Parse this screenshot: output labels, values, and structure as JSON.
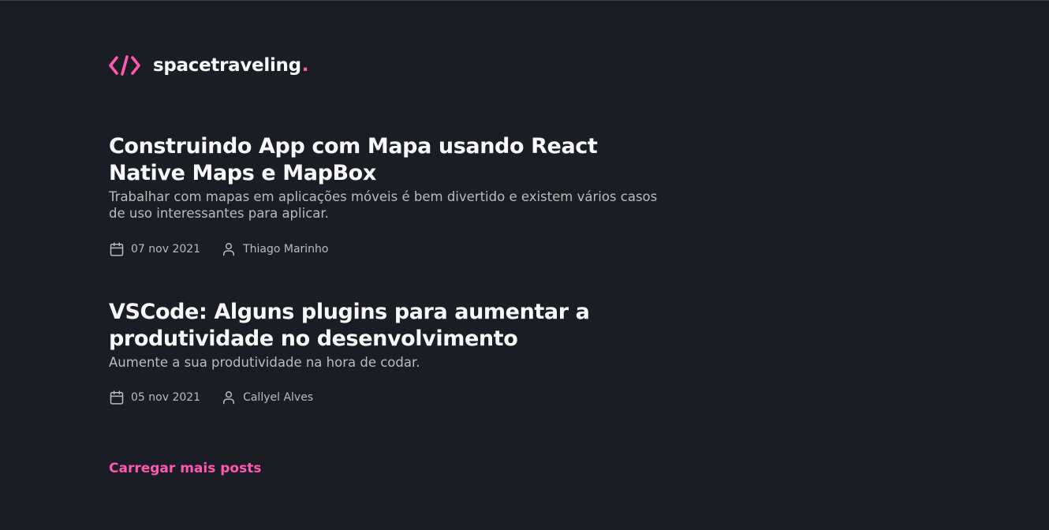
{
  "header": {
    "logo_text": "spacetraveling",
    "logo_dot": ".",
    "accent_color": "#ff57b2",
    "logo_icon": "code-brackets-icon"
  },
  "posts": [
    {
      "title": "Construindo App com Mapa usando React Native Maps e MapBox",
      "subtitle": "Trabalhar com mapas em aplicações móveis é bem divertido e existem vários casos de uso interessantes para aplicar.",
      "date": "07 nov 2021",
      "author": "Thiago Marinho"
    },
    {
      "title": "VSCode: Alguns plugins para aumentar a produtividade no desenvolvimento",
      "subtitle": "Aumente a sua produtividade na hora de codar.",
      "date": "05 nov 2021",
      "author": "Callyel Alves"
    }
  ],
  "load_more_label": "Carregar mais posts"
}
